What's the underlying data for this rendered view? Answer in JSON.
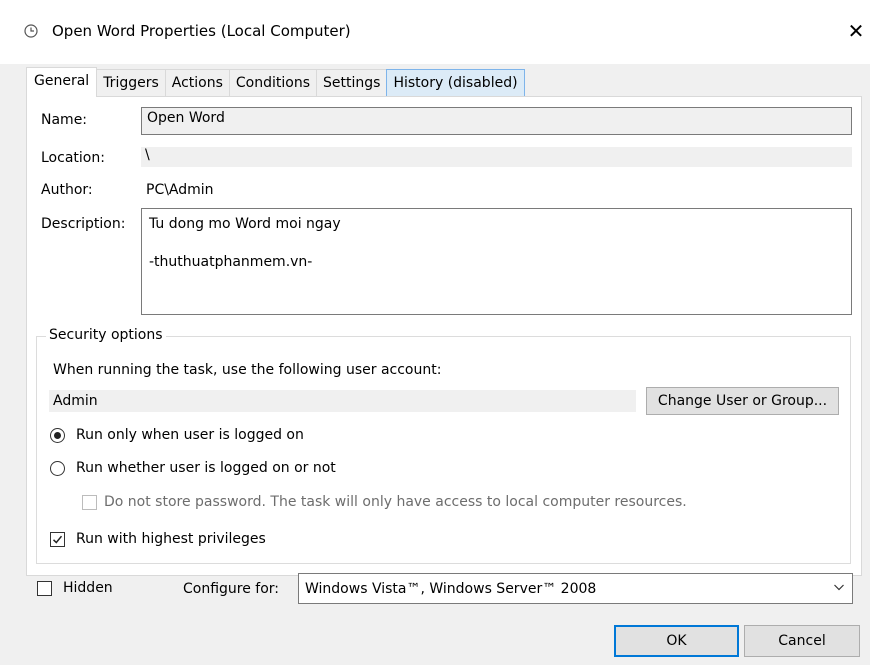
{
  "window": {
    "title": "Open Word Properties (Local Computer)",
    "close_label": "✕"
  },
  "tabs": [
    {
      "label": "General",
      "active": true
    },
    {
      "label": "Triggers"
    },
    {
      "label": "Actions"
    },
    {
      "label": "Conditions"
    },
    {
      "label": "Settings"
    },
    {
      "label": "History (disabled)"
    }
  ],
  "general": {
    "name_label": "Name:",
    "name_value": "Open Word",
    "location_label": "Location:",
    "location_value": "\\",
    "author_label": "Author:",
    "author_value": "PC\\Admin",
    "description_label": "Description:",
    "description_value": "Tu dong mo Word moi ngay\n\n-thuthuatphanmem.vn-"
  },
  "security": {
    "title": "Security options",
    "account_prompt": "When running the task, use the following user account:",
    "account_value": "Admin",
    "change_button": "Change User or Group...",
    "radio_logged_on": "Run only when user is logged on",
    "radio_whether": "Run whether user is logged on or not",
    "no_store_password": "Do not store password.  The task will only have access to local computer resources.",
    "highest_privileges": "Run with highest privileges",
    "selected_radio": "logged_on",
    "highest_checked": true,
    "no_store_checked": false
  },
  "footer": {
    "hidden_label": "Hidden",
    "hidden_checked": false,
    "configure_label": "Configure for:",
    "configure_value": "Windows Vista™, Windows Server™ 2008",
    "ok_button": "OK",
    "cancel_button": "Cancel"
  },
  "colors": {
    "accent": "#0078d7",
    "tab_hover": "#dcebf7"
  }
}
